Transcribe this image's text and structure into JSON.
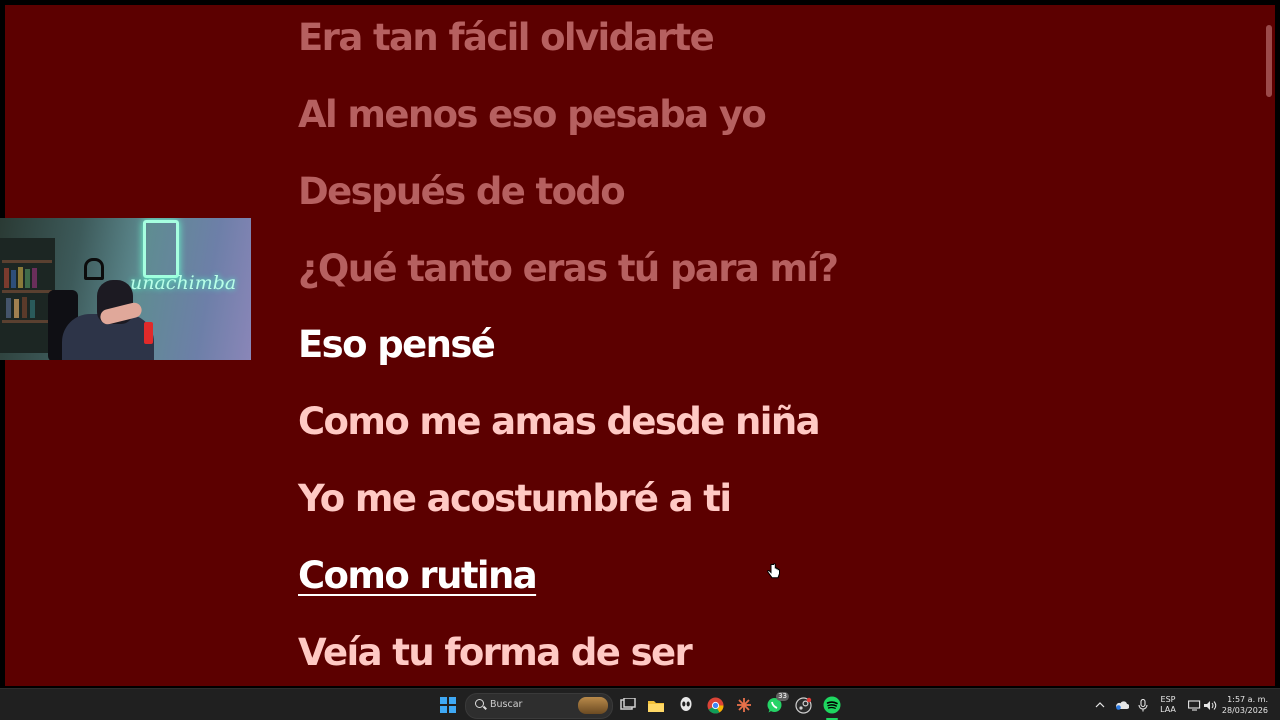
{
  "lyrics": [
    {
      "text": "Era tan fácil olvidarte",
      "state": "past"
    },
    {
      "text": "Al menos eso pesaba yo",
      "state": "past"
    },
    {
      "text": "Después de todo",
      "state": "past"
    },
    {
      "text": "¿Qué tanto eras tú para mí?",
      "state": "past"
    },
    {
      "text": "Eso pensé",
      "state": "current"
    },
    {
      "text": "Como me amas desde niña",
      "state": "upcoming"
    },
    {
      "text": "Yo me acostumbré a ti",
      "state": "upcoming"
    },
    {
      "text": "Como rutina",
      "state": "hover"
    },
    {
      "text": "Veía tu forma de ser",
      "state": "upcoming"
    }
  ],
  "webcam": {
    "neon_text": "unachimba"
  },
  "taskbar": {
    "search_placeholder": "Buscar",
    "whatsapp_badge": "33",
    "apps": [
      "start-icon",
      "search-icon",
      "task-view-icon",
      "file-explorer-icon",
      "alien-app-icon",
      "chrome-icon",
      "sunburst-app-icon",
      "whatsapp-icon",
      "steam-icon",
      "spotify-icon"
    ]
  },
  "tray": {
    "language_top": "ESP",
    "language_bottom": "LAA",
    "time": "1:57 a. m.",
    "date": "28/03/2026"
  },
  "colors": {
    "background": "#5c0000",
    "past_line": "#b66060",
    "current_line": "#ffffff",
    "upcoming_line": "#ffc9c4",
    "taskbar": "#202020",
    "spotify_green": "#1ed760"
  }
}
